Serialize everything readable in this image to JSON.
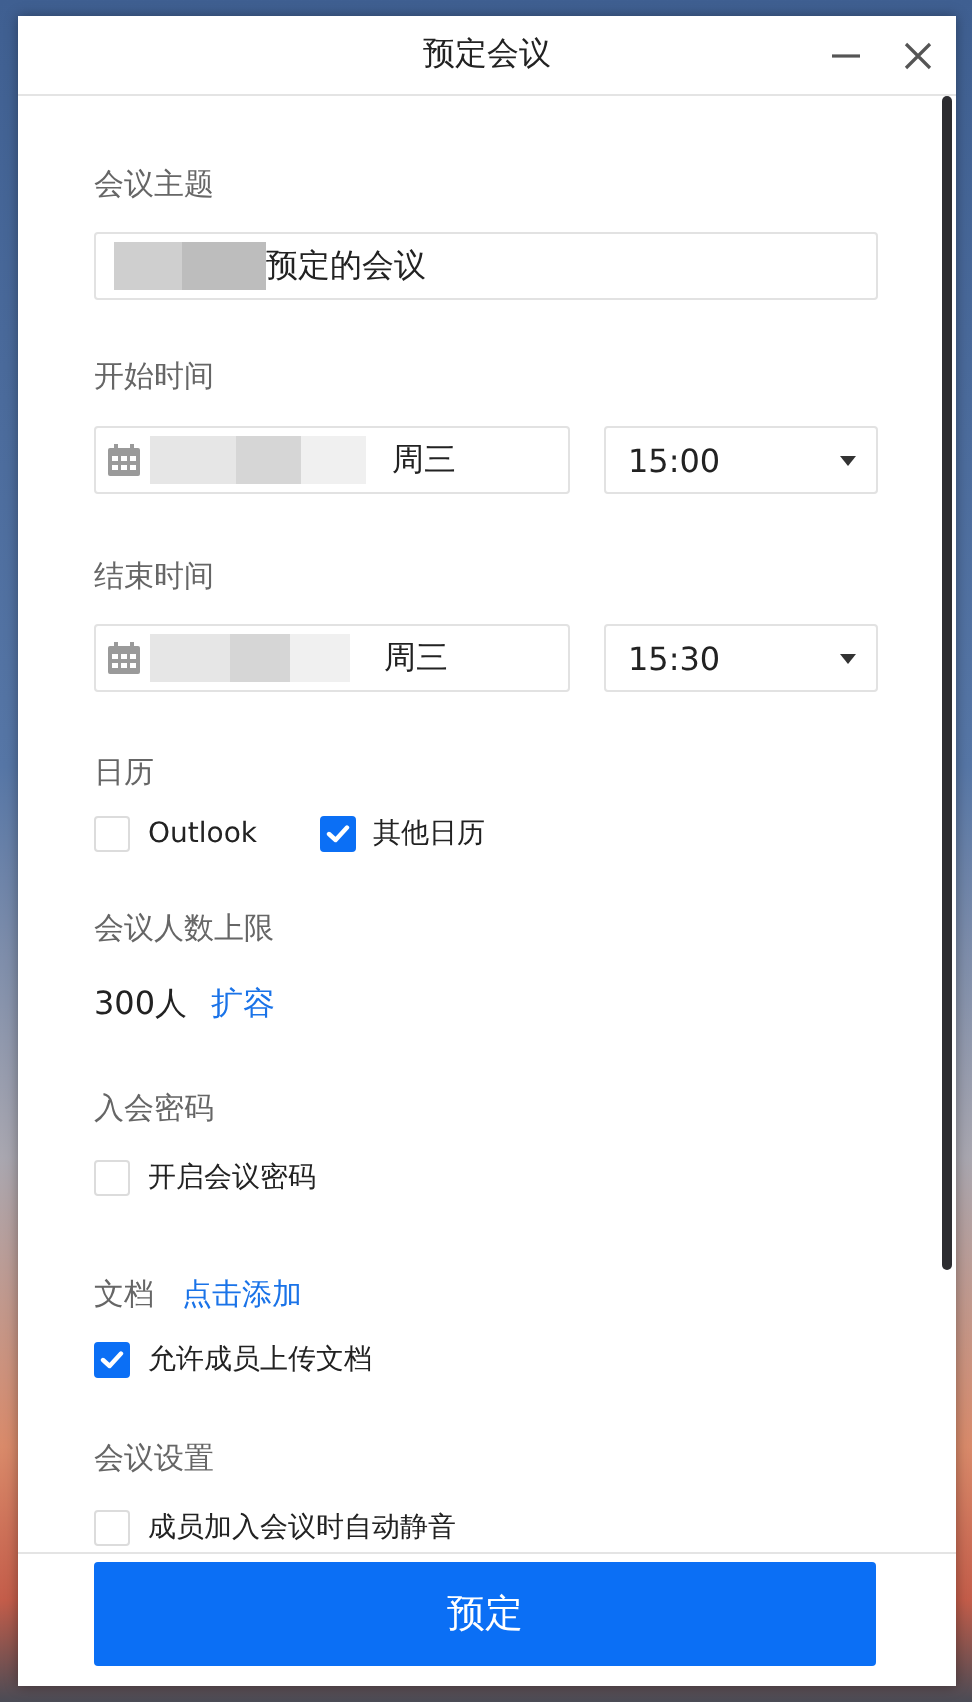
{
  "window": {
    "title": "预定会议"
  },
  "subject": {
    "label": "会议主题",
    "value": "预定的会议"
  },
  "start": {
    "label": "开始时间",
    "weekday": "周三",
    "time": "15:00"
  },
  "end": {
    "label": "结束时间",
    "weekday": "周三",
    "time": "15:30"
  },
  "calendar": {
    "label": "日历",
    "options": [
      {
        "label": "Outlook",
        "checked": false
      },
      {
        "label": "其他日历",
        "checked": true
      }
    ]
  },
  "capacity": {
    "label": "会议人数上限",
    "value": "300人",
    "link": "扩容"
  },
  "password": {
    "label": "入会密码",
    "options": [
      {
        "label": "开启会议密码",
        "checked": false
      }
    ]
  },
  "documents": {
    "label": "文档",
    "link": "点击添加",
    "options": [
      {
        "label": "允许成员上传文档",
        "checked": true
      }
    ]
  },
  "settings": {
    "label": "会议设置",
    "options": [
      {
        "label": "成员加入会议时自动静音",
        "checked": false
      }
    ]
  },
  "submit": "预定"
}
